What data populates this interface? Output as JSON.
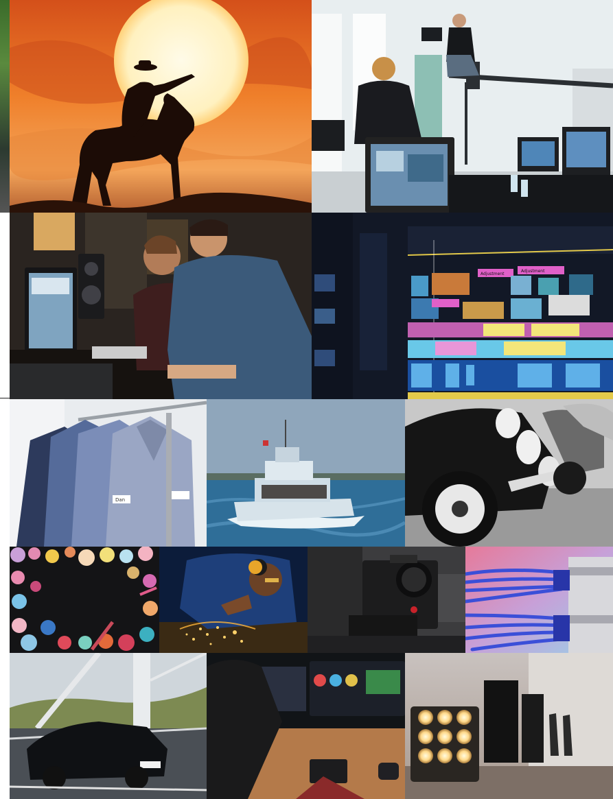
{
  "collage": {
    "background": "#ffffff",
    "tiles": [
      {
        "subject": "cowboy-sunset"
      },
      {
        "subject": "film-studio-crane"
      },
      {
        "subject": "editors-at-desk"
      },
      {
        "subject": "editing-timeline"
      },
      {
        "subject": "work-shirts"
      },
      {
        "subject": "boat-at-sea"
      },
      {
        "subject": "vintage-cars"
      },
      {
        "subject": "makeup-palette"
      },
      {
        "subject": "welder-sparks"
      },
      {
        "subject": "cinema-camera"
      },
      {
        "subject": "network-cables"
      },
      {
        "subject": "car-on-bridge"
      },
      {
        "subject": "color-grading-desk"
      },
      {
        "subject": "studio-lights"
      }
    ],
    "shirt_name_tag": "Dan",
    "colors": {
      "sunset_orange": "#ef7f2a",
      "sunset_sun": "#fff7d6",
      "timeline_pink": "#e060c8",
      "timeline_yellow": "#f3e67a",
      "timeline_cyan": "#69c8e8",
      "sea_blue": "#3a6f97",
      "cable_blue": "#3b4fd8"
    }
  }
}
